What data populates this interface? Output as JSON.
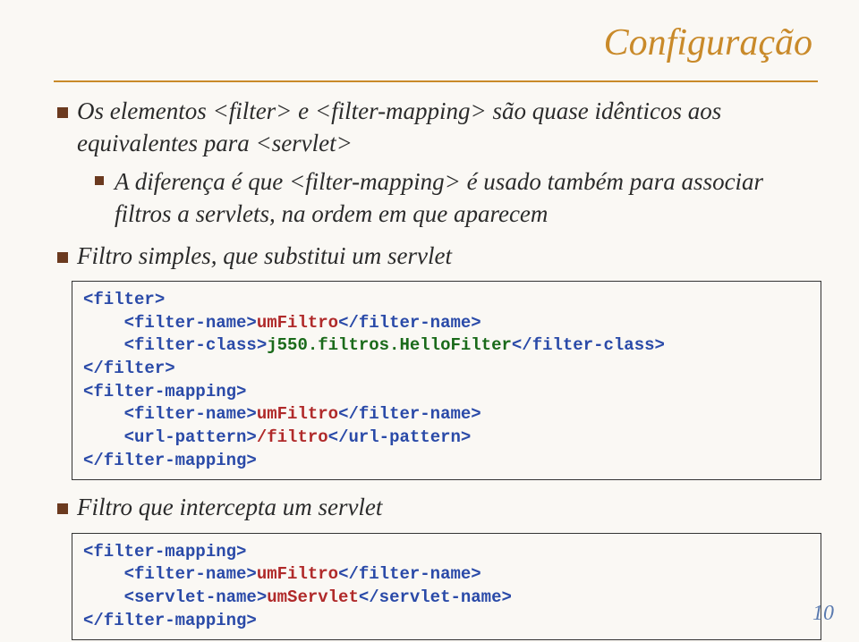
{
  "title": "Configuração",
  "bul1_a": "Os elementos ",
  "bul1_b": " e ",
  "bul1_c": " são quase idênticos aos equivalentes para ",
  "tag_filter": "<filter>",
  "tag_fmap": "<filter-mapping>",
  "tag_servlet": "<servlet>",
  "sub1_a": "A diferença é que ",
  "sub1_b": " é usado também para associar filtros a servlets, na ordem em que aparecem",
  "bul2": "Filtro simples, que substitui um servlet",
  "code1": {
    "l1a": "<filter>",
    "l2a": "    <filter-name>",
    "l2b": "umFiltro",
    "l2c": "</filter-name>",
    "l3a": "    <filter-class>",
    "l3b": "j550.filtros.HelloFilter",
    "l3c": "</filter-class>",
    "l4a": "</filter>",
    "l5a": "<filter-mapping>",
    "l6a": "    <filter-name>",
    "l6b": "umFiltro",
    "l6c": "</filter-name>",
    "l7a": "    <url-pattern>",
    "l7b": "/filtro",
    "l7c": "</url-pattern>",
    "l8a": "</filter-mapping>"
  },
  "bul3": "Filtro que intercepta um servlet",
  "code2": {
    "l1a": "<filter-mapping>",
    "l2a": "    <filter-name>",
    "l2b": "umFiltro",
    "l2c": "</filter-name>",
    "l3a": "    <servlet-name>",
    "l3b": "umServlet",
    "l3c": "</servlet-name>",
    "l4a": "</filter-mapping>"
  },
  "pagenum": "10"
}
